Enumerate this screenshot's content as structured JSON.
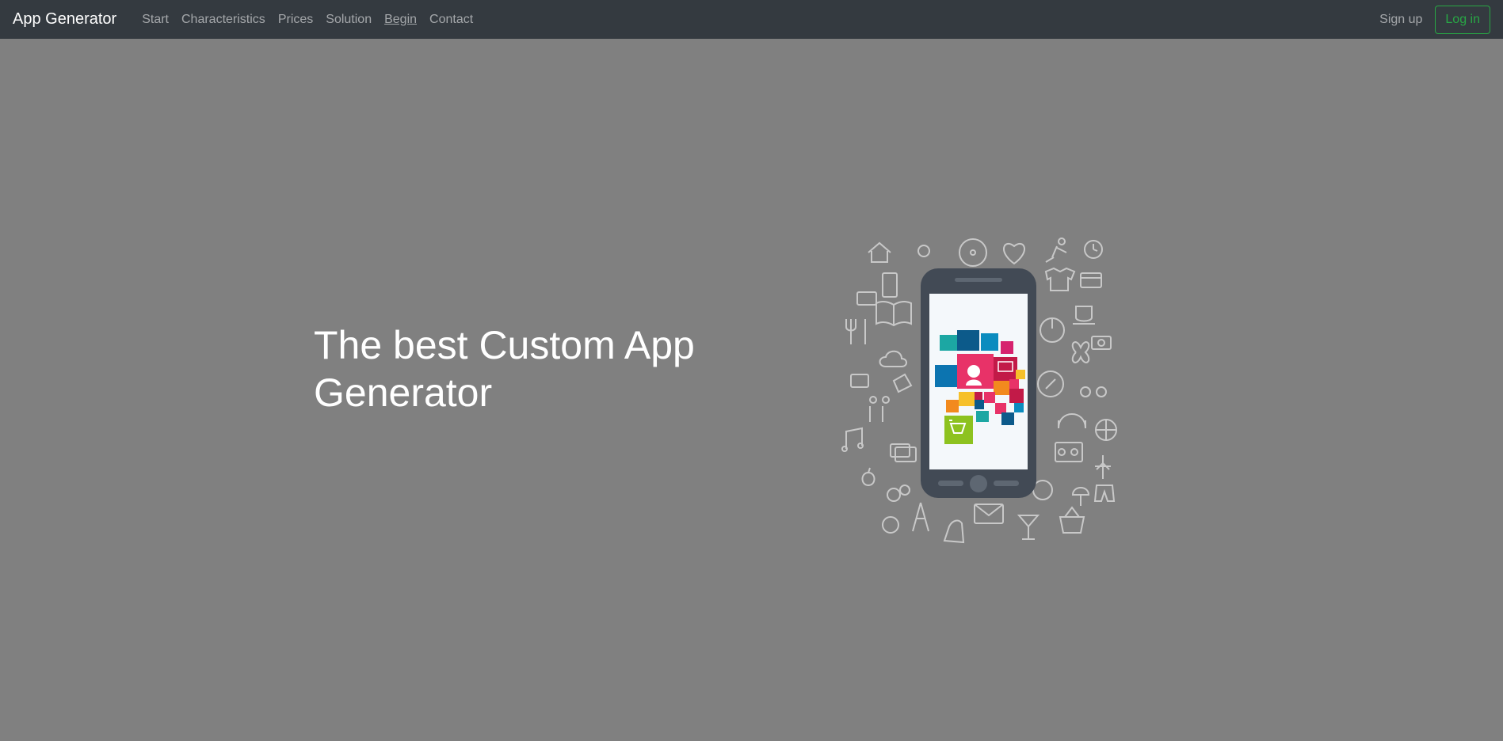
{
  "navbar": {
    "brand": "App Generator",
    "links": [
      "Start",
      "Characteristics",
      "Prices",
      "Solution",
      "Begin",
      "Contact"
    ],
    "signup": "Sign up",
    "login": "Log in"
  },
  "hero": {
    "title": "The best Custom App Generator"
  },
  "colors": {
    "navbar_bg": "#343a40",
    "page_bg": "#808080",
    "login_accent": "#28a745"
  }
}
